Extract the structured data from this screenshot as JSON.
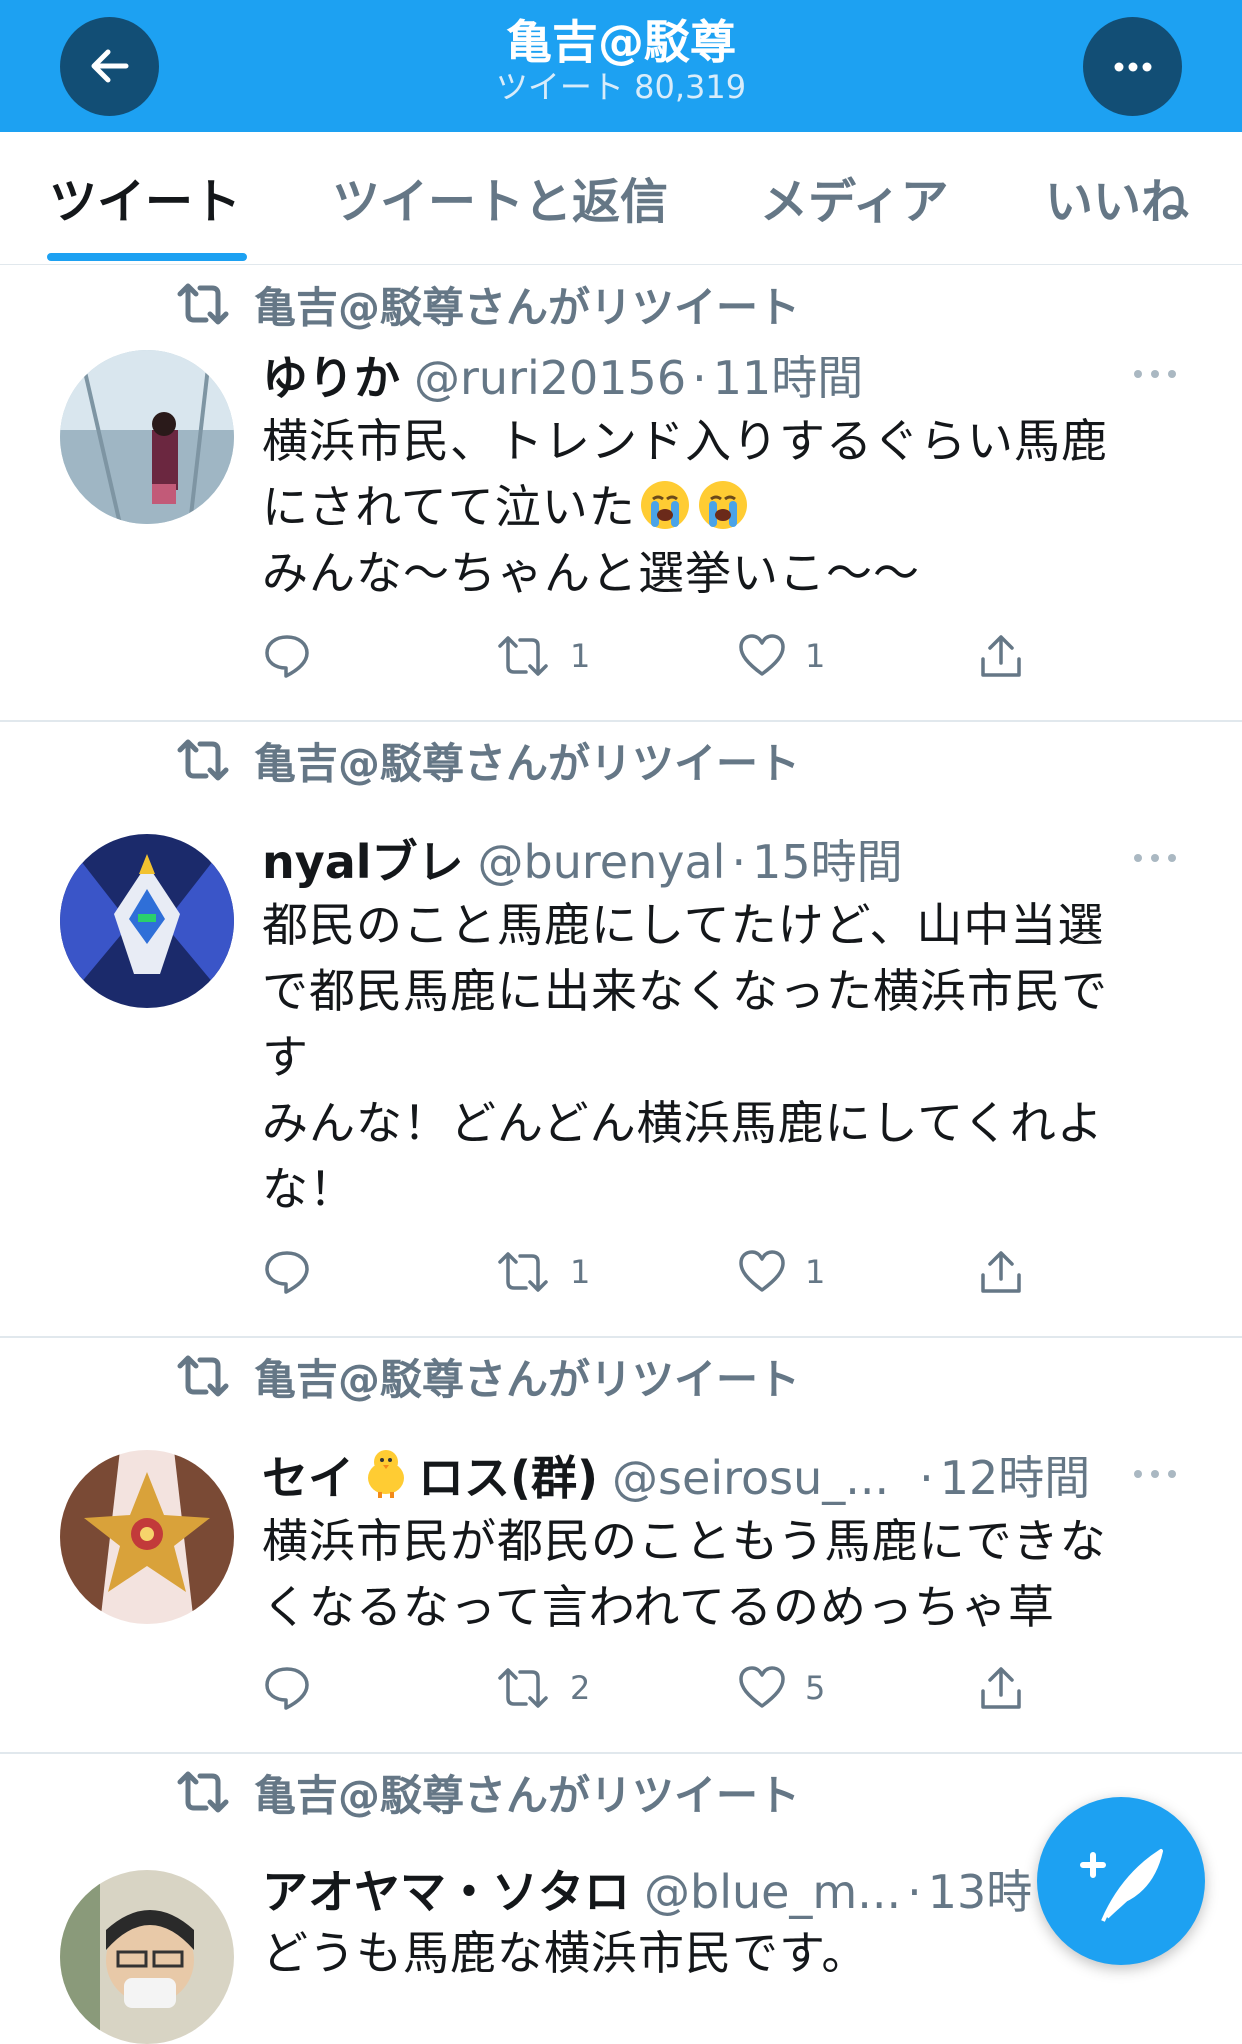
{
  "header": {
    "title": "亀吉@駁尊",
    "tweet_count": "ツイート 80,319",
    "back_icon": "arrow-left-icon",
    "more_icon": "more-icon",
    "color": "#1da1f2"
  },
  "tabs": [
    {
      "label": "ツイート",
      "active": true
    },
    {
      "label": "ツイートと返信",
      "active": false
    },
    {
      "label": "メディア",
      "active": false
    },
    {
      "label": "いいね",
      "active": false
    }
  ],
  "tweets": [
    {
      "retweet_label": "亀吉@駁尊さんがリツイート",
      "name": "ゆりか",
      "handle": "@ruri20156",
      "dot": "·",
      "time": "11時間",
      "lines": [
        "横浜市民、トレンド入りするぐらい馬鹿",
        "にされてて泣いた",
        "みんな〜ちゃんと選挙いこ〜〜"
      ],
      "emoji_count": 2,
      "retweets": "1",
      "likes": "1"
    },
    {
      "retweet_label": "亀吉@駁尊さんがリツイート",
      "name": "nyalブレ",
      "handle": "@burenyal",
      "dot": "·",
      "time": "15時間",
      "lines": [
        "都民のこと馬鹿にしてたけど、山中当選",
        "で都民馬鹿に出来なくなった横浜市民で",
        "す",
        "みんな！どんどん横浜馬鹿にしてくれよ",
        "な！"
      ],
      "retweets": "1",
      "likes": "1"
    },
    {
      "retweet_label": "亀吉@駁尊さんがリツイート",
      "name_a": "セイ",
      "name_b": "ロス(群)",
      "handle": "@seirosu_...",
      "dot": "·",
      "time": "12時間",
      "lines": [
        "横浜市民が都民のこともう馬鹿にできな",
        "くなるなって言われてるのめっちゃ草"
      ],
      "retweets": "2",
      "likes": "5"
    },
    {
      "retweet_label": "亀吉@駁尊さんがリツイート",
      "name": "アオヤマ・ソタロ",
      "handle": "@blue_m...",
      "dot": "·",
      "time": "13時",
      "lines": [
        "どうも馬鹿な横浜市民です。"
      ]
    }
  ],
  "fab": {
    "icon": "compose-tweet-icon"
  }
}
